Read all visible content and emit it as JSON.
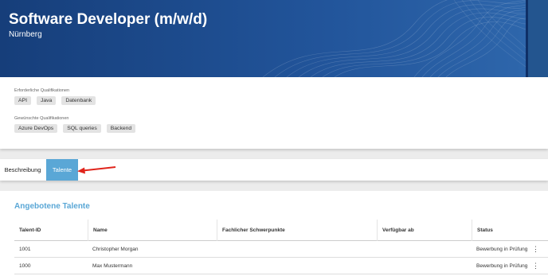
{
  "header": {
    "title": "Software Developer (m/w/d)",
    "location": "Nürnberg"
  },
  "qualifications": {
    "required_label": "Erforderliche Qualifikationen",
    "required": [
      "API",
      "Java",
      "Datenbank"
    ],
    "desired_label": "Gewünschte Qualifikationen",
    "desired": [
      "Azure DevOps",
      "SQL queries",
      "Backend"
    ]
  },
  "tabs": [
    {
      "label": "Beschreibung",
      "active": false
    },
    {
      "label": "Talente",
      "active": true
    }
  ],
  "talents": {
    "title": "Angebotene Talente",
    "columns": [
      "Talent-ID",
      "Name",
      "Fachlicher Schwerpunkte",
      "Verfügbar ab",
      "Status"
    ],
    "rows": [
      {
        "id": "1001",
        "name": "Christopher Morgan",
        "focus": "",
        "available": "",
        "status": "Bewerbung in Prüfung"
      },
      {
        "id": "1000",
        "name": "Max Mustermann",
        "focus": "",
        "available": "",
        "status": "Bewerbung in Prüfung"
      }
    ]
  },
  "colors": {
    "banner": "#1f4a8c",
    "accent": "#5aa7d6",
    "annotation_arrow": "#e0241b"
  },
  "icons": {
    "row_menu": "kebab-menu-icon",
    "annotation": "red-arrow-icon"
  }
}
